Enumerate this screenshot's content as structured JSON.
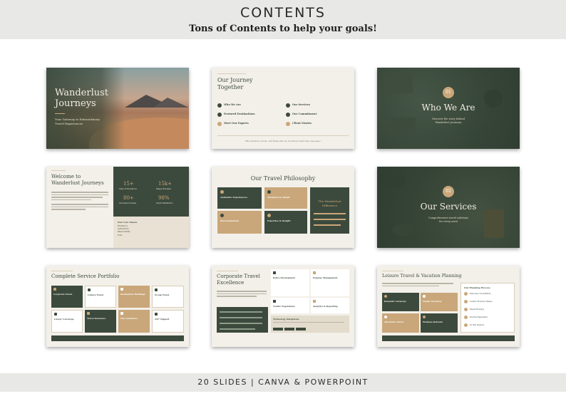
{
  "header": {
    "title": "CONTENTS",
    "subtitle": "Tons of Contents to help your goals!"
  },
  "footer": {
    "text": "20 SLIDES | CANVA & POWERPOINT"
  },
  "slides": {
    "s1": {
      "title_line1": "Wanderlust",
      "title_line2": "Journeys",
      "tagline_line1": "Your Gateway to Extraordinary",
      "tagline_line2": "Travel Experiences"
    },
    "s2": {
      "title_line1": "Our Journey",
      "title_line2": "Together",
      "items": [
        "Who We Are",
        "Our Services",
        "Featured Destinations",
        "Our Commitment",
        "Meet Our Experts",
        "Client Stories"
      ],
      "quote": "\"The world is a book, and those who do not travel read only one page.\""
    },
    "s3": {
      "number": "01",
      "title": "Who We Are",
      "caption_line1": "Discover the story behind",
      "caption_line2": "Wanderlust Journeys"
    },
    "s4": {
      "title_line1": "Welcome to",
      "title_line2": "Wanderlust Journeys",
      "stats": [
        {
          "value": "15+",
          "label": "Years of Excellence"
        },
        {
          "value": "15k+",
          "label": "Happy Travelers"
        },
        {
          "value": "80+",
          "label": "Countries Covered"
        },
        {
          "value": "98%",
          "label": "Client Satisfaction"
        }
      ],
      "values_heading": "Our Core Values",
      "values": [
        "Excellence",
        "Authenticity",
        "Responsibility",
        "Trust"
      ]
    },
    "s5": {
      "title": "Our Travel Philosophy",
      "cards": [
        "Authentic Experiences",
        "Attention to Detail",
        "Personalization",
        "Expertise & Insight"
      ],
      "side_title_line1": "The Wanderlust",
      "side_title_line2": "Difference"
    },
    "s6": {
      "number": "02",
      "title": "Our Services",
      "caption_line1": "Comprehensive travel solutions",
      "caption_line2": "for every need"
    },
    "s7": {
      "title": "Complete Service Portfolio",
      "cards": [
        "Corporate Travel",
        "Leisure Travel",
        "Destination Weddings",
        "Group Travel",
        "Luxury Concierge",
        "Travel Insurance",
        "Visa Assistance",
        "24/7 Support"
      ]
    },
    "s8": {
      "title_line1": "Corporate Travel",
      "title_line2": "Excellence",
      "features": [
        "Policy Development",
        "Expense Management",
        "Vendor Negotiation",
        "Analytics & Reporting"
      ],
      "box_heading": "Technology Integration"
    },
    "s9": {
      "title": "Leisure Travel & Vacation Planning",
      "cards": [
        "Romantic Getaways",
        "Family Vacations",
        "Adventure Travel",
        "Wellness Retreats"
      ],
      "process_heading": "Our Planning Process",
      "steps": [
        "Discovery Consultation",
        "Custom Itinerary Design",
        "Expert Booking",
        "Pre-Trip Preparation",
        "On-Trip Support"
      ]
    }
  }
}
